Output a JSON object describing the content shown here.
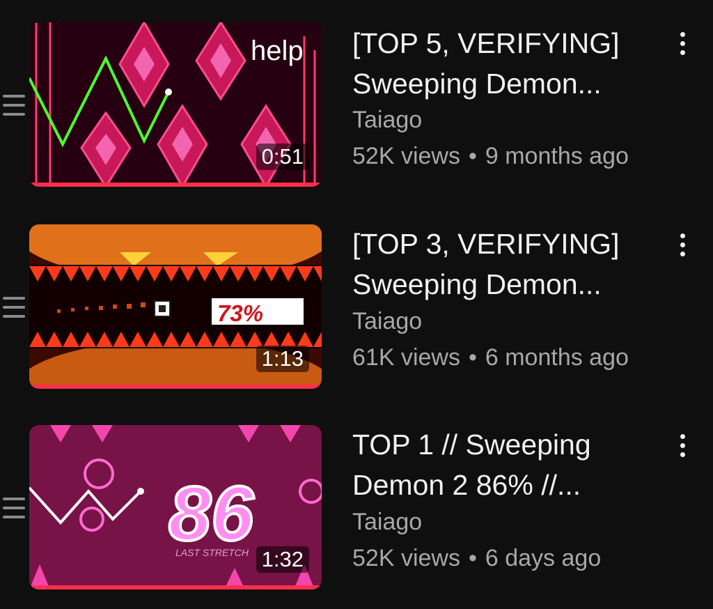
{
  "videos": [
    {
      "title_line1": "[TOP 5, VERIFYING]",
      "title_line2": "Sweeping Demon...",
      "channel": "Taiago",
      "views": "52K views",
      "age": "9 months ago",
      "duration": "0:51",
      "thumb_text": "help",
      "progress": 1.0
    },
    {
      "title_line1": "[TOP 3, VERIFYING]",
      "title_line2": "Sweeping Demon...",
      "channel": "Taiago",
      "views": "61K views",
      "age": "6 months ago",
      "duration": "1:13",
      "thumb_text": "73%",
      "progress": 1.0
    },
    {
      "title_line1": "TOP 1 // Sweeping",
      "title_line2": "Demon 2 86% //...",
      "channel": "Taiago",
      "views": "52K views",
      "age": "6 days ago",
      "duration": "1:32",
      "thumb_text": "86",
      "thumb_subtext": "LAST STRETCH",
      "progress": 1.0
    }
  ],
  "separator": "•",
  "icons": {
    "drag": "drag-handle-icon",
    "menu": "more-vert-icon"
  },
  "colors": {
    "progress": "#ff2f4c",
    "background": "#0f0f0f",
    "secondary_text": "#a8a8a8"
  }
}
